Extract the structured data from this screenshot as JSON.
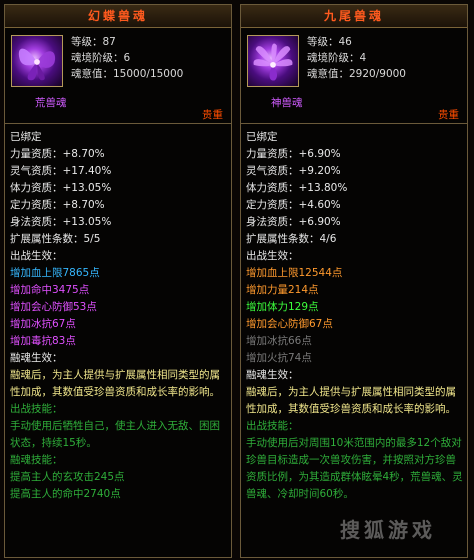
{
  "left": {
    "title": "幻蝶兽魂",
    "stats": [
      "等级：87",
      "魂境阶级：6",
      "魂意值：15000/15000"
    ],
    "kind": "荒兽魂",
    "rarity": "贵重",
    "lines": [
      {
        "text": "已绑定",
        "color": "white"
      },
      {
        "text": "力量资质：+8.70%",
        "color": "white"
      },
      {
        "text": "灵气资质：+17.40%",
        "color": "white"
      },
      {
        "text": "体力资质：+13.05%",
        "color": "white"
      },
      {
        "text": "定力资质：+8.70%",
        "color": "white"
      },
      {
        "text": "身法资质：+13.05%",
        "color": "white"
      },
      {
        "text": "扩展属性条数：5/5",
        "color": "white"
      },
      {
        "text": "出战生效：",
        "color": "white"
      },
      {
        "text": "增加血上限7865点",
        "color": "blue"
      },
      {
        "text": "增加命中3475点",
        "color": "mag"
      },
      {
        "text": "增加会心防御53点",
        "color": "mag"
      },
      {
        "text": "增加冰抗67点",
        "color": "mag"
      },
      {
        "text": "增加毒抗83点",
        "color": "mag"
      },
      {
        "text": "融魂生效：",
        "color": "white"
      },
      {
        "text": "融魂后，为主人提供与扩展属性相同类型的属性加成，其数值受珍兽资质和成长率的影响。",
        "color": "yellow",
        "wrap": true
      },
      {
        "text": "出战技能：",
        "color": "dgreen"
      },
      {
        "text": "手动使用后牺牲自己，使主人进入无敌、困困状态，持续15秒。",
        "color": "dgreen",
        "wrap": true
      },
      {
        "text": "融魂技能：",
        "color": "dgreen"
      },
      {
        "text": "提高主人的玄攻击245点",
        "color": "dgreen"
      },
      {
        "text": "提高主人的命中2740点",
        "color": "dgreen"
      }
    ]
  },
  "right": {
    "title": "九尾兽魂",
    "stats": [
      "等级：46",
      "魂境阶级：4",
      "魂意值：2920/9000"
    ],
    "kind": "神兽魂",
    "rarity": "贵重",
    "lines": [
      {
        "text": "已绑定",
        "color": "white"
      },
      {
        "text": "力量资质：+6.90%",
        "color": "white"
      },
      {
        "text": "灵气资质：+9.20%",
        "color": "white"
      },
      {
        "text": "体力资质：+13.80%",
        "color": "white"
      },
      {
        "text": "定力资质：+4.60%",
        "color": "white"
      },
      {
        "text": "身法资质：+6.90%",
        "color": "white"
      },
      {
        "text": "扩展属性条数：4/6",
        "color": "white"
      },
      {
        "text": "出战生效：",
        "color": "white"
      },
      {
        "text": "增加血上限12544点",
        "color": "orange"
      },
      {
        "text": "增加力量214点",
        "color": "orange"
      },
      {
        "text": "增加体力129点",
        "color": "green"
      },
      {
        "text": "增加会心防御67点",
        "color": "orange"
      },
      {
        "text": "增加冰抗66点",
        "color": "gray"
      },
      {
        "text": "增加火抗74点",
        "color": "gray"
      },
      {
        "text": "融魂生效：",
        "color": "white"
      },
      {
        "text": "融魂后，为主人提供与扩展属性相同类型的属性加成，其数值受珍兽资质和成长率的影响。",
        "color": "yellow",
        "wrap": true
      },
      {
        "text": "出战技能：",
        "color": "dgreen"
      },
      {
        "text": "手动使用后对周围10米范围内的最多12个敌对珍兽目标造成一次兽攻伤害，并按照对方珍兽资质比例，为其造成群体眩晕4秒，荒兽魂、灵兽魂、冷却时间60秒。",
        "color": "dgreen",
        "wrap": true
      }
    ]
  },
  "colors": {
    "title": "#ff5a1e",
    "rarity": "#ff4d00",
    "border": "#6b5a3a"
  },
  "watermark": "搜狐游戏"
}
